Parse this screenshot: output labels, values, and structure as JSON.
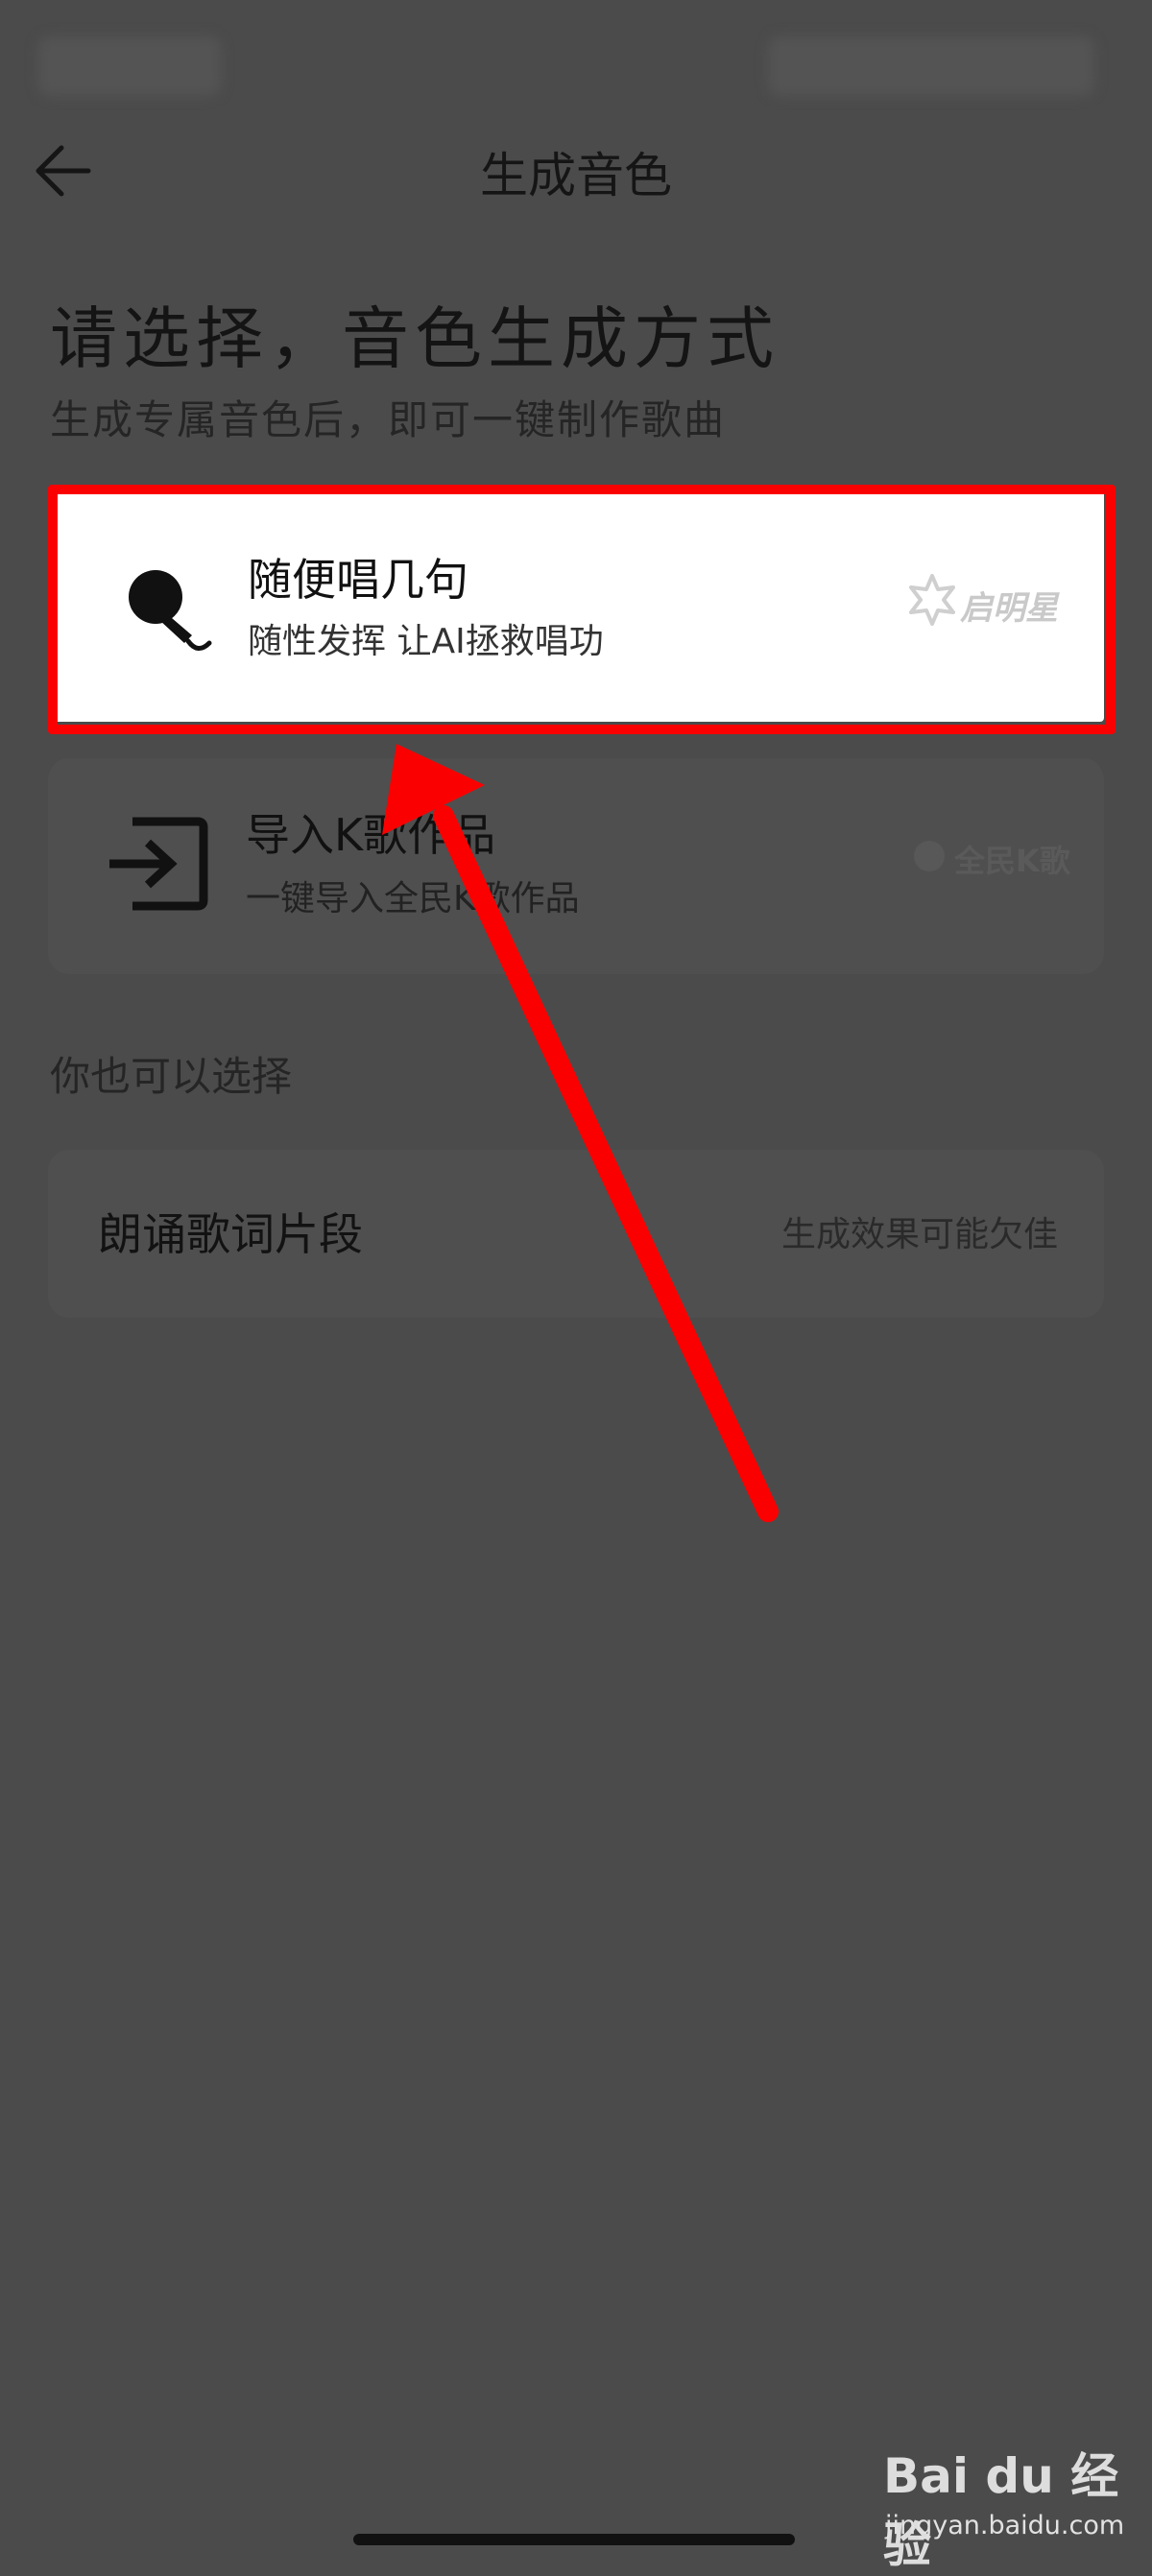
{
  "header": {
    "title": "生成音色",
    "back_icon": "arrow-left-icon"
  },
  "intro": {
    "heading": "请选择，音色生成方式",
    "subheading": "生成专属音色后，即可一键制作歌曲"
  },
  "options": [
    {
      "title": "随便唱几句",
      "subtitle": "随性发挥 让AI拯救唱功",
      "brand": "启明星",
      "icon": "microphone-icon",
      "selected": true
    },
    {
      "title": "导入K歌作品",
      "subtitle": "一键导入全民K歌作品",
      "brand": "全民K歌",
      "icon": "import-icon",
      "selected": false
    }
  ],
  "alternative": {
    "label": "你也可以选择",
    "item_title": "朗诵歌词片段",
    "item_hint": "生成效果可能欠佳"
  },
  "annotation": {
    "highlight_color": "#fb0000",
    "arrow_color": "#fb0000"
  },
  "watermark": {
    "logo_text": "Bai du 经验",
    "url": "jingyan.baidu.com"
  },
  "colors": {
    "overlay": "#4b4b4b",
    "card_active": "#ffffff"
  }
}
